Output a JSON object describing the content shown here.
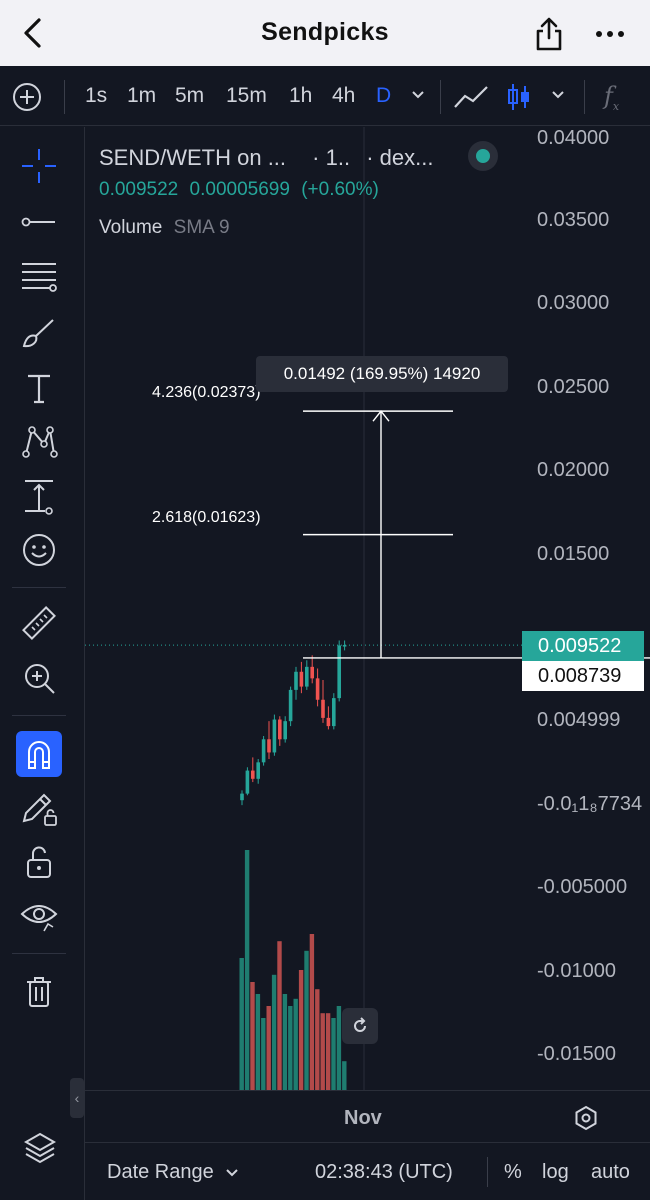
{
  "header": {
    "title": "Sendpicks"
  },
  "toolbar": {
    "timeframes": [
      "1s",
      "1m",
      "5m",
      "15m",
      "1h",
      "4h",
      "D"
    ],
    "active_timeframe": "D"
  },
  "legend": {
    "symbol": "SEND/WETH on ...",
    "interval": "· 1..",
    "exchange": "· dex...",
    "last_price": "0.009522",
    "change": "0.00005699",
    "change_pct": "(+0.60%)",
    "volume_label": "Volume",
    "volume_sma": "SMA 9"
  },
  "price_scale": {
    "ticks": [
      "0.04000",
      "0.03500",
      "0.03000",
      "0.02500",
      "0.02000",
      "0.01500",
      "0.004999",
      "-0.0₁1₈7734",
      "-0.005000",
      "-0.01000",
      "-0.01500"
    ],
    "last_price_badge": "0.009522",
    "crosshair_badge": "0.008739"
  },
  "measure_tooltip": "0.01492 (169.95%) 14920",
  "fib_levels": [
    {
      "label": "4.236(0.02373)",
      "value": 0.02373
    },
    {
      "label": "2.618(0.01623)",
      "value": 0.01623
    }
  ],
  "time_axis": {
    "label": "Nov"
  },
  "bottom_bar": {
    "date_range": "Date Range",
    "clock": "02:38:43 (UTC)",
    "percent": "%",
    "log": "log",
    "auto": "auto"
  },
  "colors": {
    "up": "#26a69a",
    "down": "#ef5350",
    "accent": "#2962ff",
    "background": "#131722"
  },
  "chart_data": {
    "type": "candlestick",
    "y_range": [
      -0.0175,
      0.0405
    ],
    "candles": [
      {
        "o": 0.0001,
        "h": 0.0007,
        "l": -0.0002,
        "c": 0.0005
      },
      {
        "o": 0.0005,
        "h": 0.0021,
        "l": 0.0004,
        "c": 0.0019
      },
      {
        "o": 0.0019,
        "h": 0.0027,
        "l": 0.0012,
        "c": 0.0014
      },
      {
        "o": 0.0014,
        "h": 0.0026,
        "l": 0.0011,
        "c": 0.0024
      },
      {
        "o": 0.0024,
        "h": 0.004,
        "l": 0.0022,
        "c": 0.0038
      },
      {
        "o": 0.0038,
        "h": 0.0049,
        "l": 0.0026,
        "c": 0.003
      },
      {
        "o": 0.003,
        "h": 0.0053,
        "l": 0.0028,
        "c": 0.005
      },
      {
        "o": 0.005,
        "h": 0.0052,
        "l": 0.0034,
        "c": 0.0038
      },
      {
        "o": 0.0038,
        "h": 0.0052,
        "l": 0.0036,
        "c": 0.0049
      },
      {
        "o": 0.0049,
        "h": 0.007,
        "l": 0.0046,
        "c": 0.0068
      },
      {
        "o": 0.0068,
        "h": 0.0082,
        "l": 0.0062,
        "c": 0.0079
      },
      {
        "o": 0.0079,
        "h": 0.0085,
        "l": 0.0066,
        "c": 0.007
      },
      {
        "o": 0.007,
        "h": 0.0086,
        "l": 0.0068,
        "c": 0.0082
      },
      {
        "o": 0.0082,
        "h": 0.0089,
        "l": 0.0072,
        "c": 0.0075
      },
      {
        "o": 0.0075,
        "h": 0.0081,
        "l": 0.0058,
        "c": 0.0062
      },
      {
        "o": 0.0062,
        "h": 0.0074,
        "l": 0.0048,
        "c": 0.0051
      },
      {
        "o": 0.0051,
        "h": 0.0058,
        "l": 0.0044,
        "c": 0.0046
      },
      {
        "o": 0.0046,
        "h": 0.0066,
        "l": 0.0044,
        "c": 0.0063
      },
      {
        "o": 0.0063,
        "h": 0.0098,
        "l": 0.0061,
        "c": 0.0095
      },
      {
        "o": 0.0095,
        "h": 0.0098,
        "l": 0.0092,
        "c": 0.009522
      }
    ],
    "volume": [
      0.55,
      1.0,
      0.45,
      0.4,
      0.3,
      0.35,
      0.48,
      0.62,
      0.4,
      0.35,
      0.38,
      0.5,
      0.58,
      0.65,
      0.42,
      0.32,
      0.32,
      0.3,
      0.35,
      0.12
    ]
  }
}
